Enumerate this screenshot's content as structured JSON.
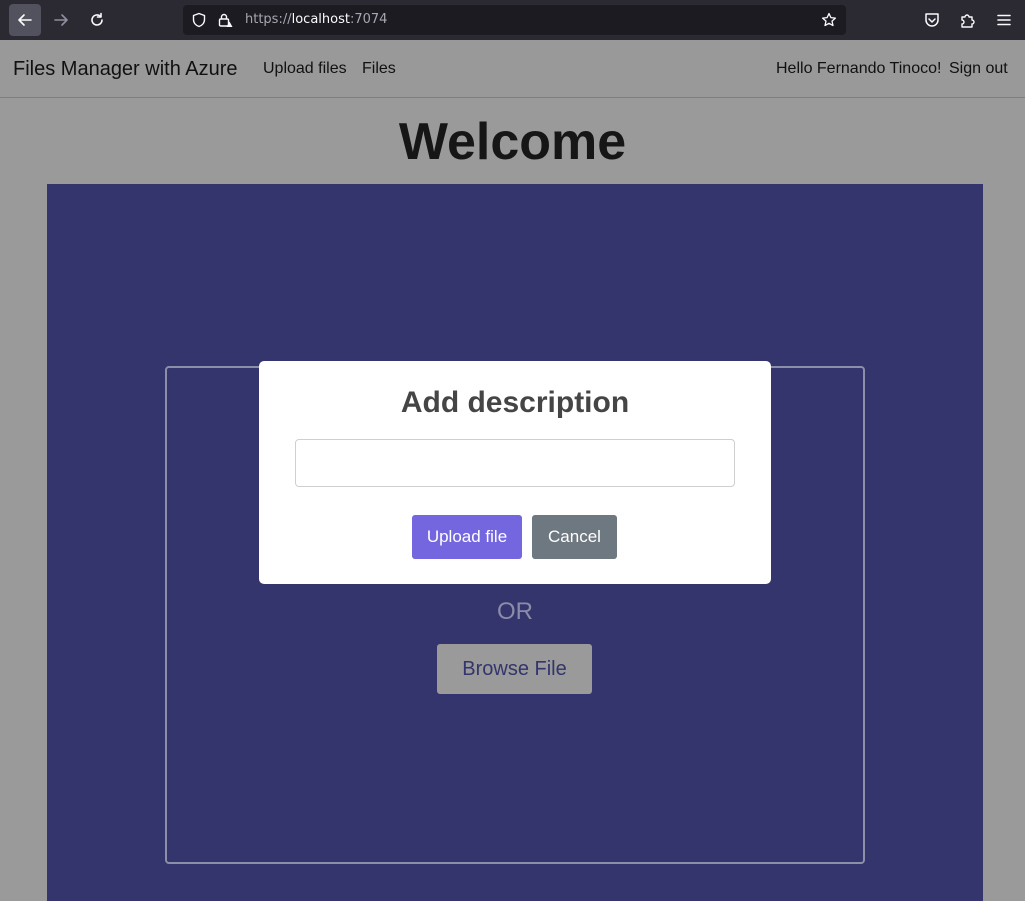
{
  "browser": {
    "url_prefix": "https://",
    "url_host": "localhost",
    "url_port": ":7074",
    "icons": {
      "back": "arrow-left-icon",
      "forward": "arrow-right-icon",
      "reload": "reload-icon",
      "shield": "shield-icon",
      "lock": "lock-warning-icon",
      "bookmark": "star-icon",
      "pocket": "pocket-icon",
      "extensions": "puzzle-icon",
      "menu": "hamburger-menu-icon"
    }
  },
  "navbar": {
    "brand": "Files Manager with Azure",
    "links": [
      "Upload files",
      "Files"
    ],
    "greeting": "Hello Fernando Tinoco!",
    "sign_out": "Sign out"
  },
  "main": {
    "title": "Welcome",
    "or_text": "OR",
    "browse_label": "Browse File"
  },
  "modal": {
    "title": "Add description",
    "input_value": "",
    "input_placeholder": "",
    "upload_label": "Upload file",
    "cancel_label": "Cancel"
  },
  "colors": {
    "drop_area": "#33356c",
    "upload_button": "#7366df",
    "cancel_button": "#6e7881",
    "overlay_gray": "#9a9a9a"
  }
}
